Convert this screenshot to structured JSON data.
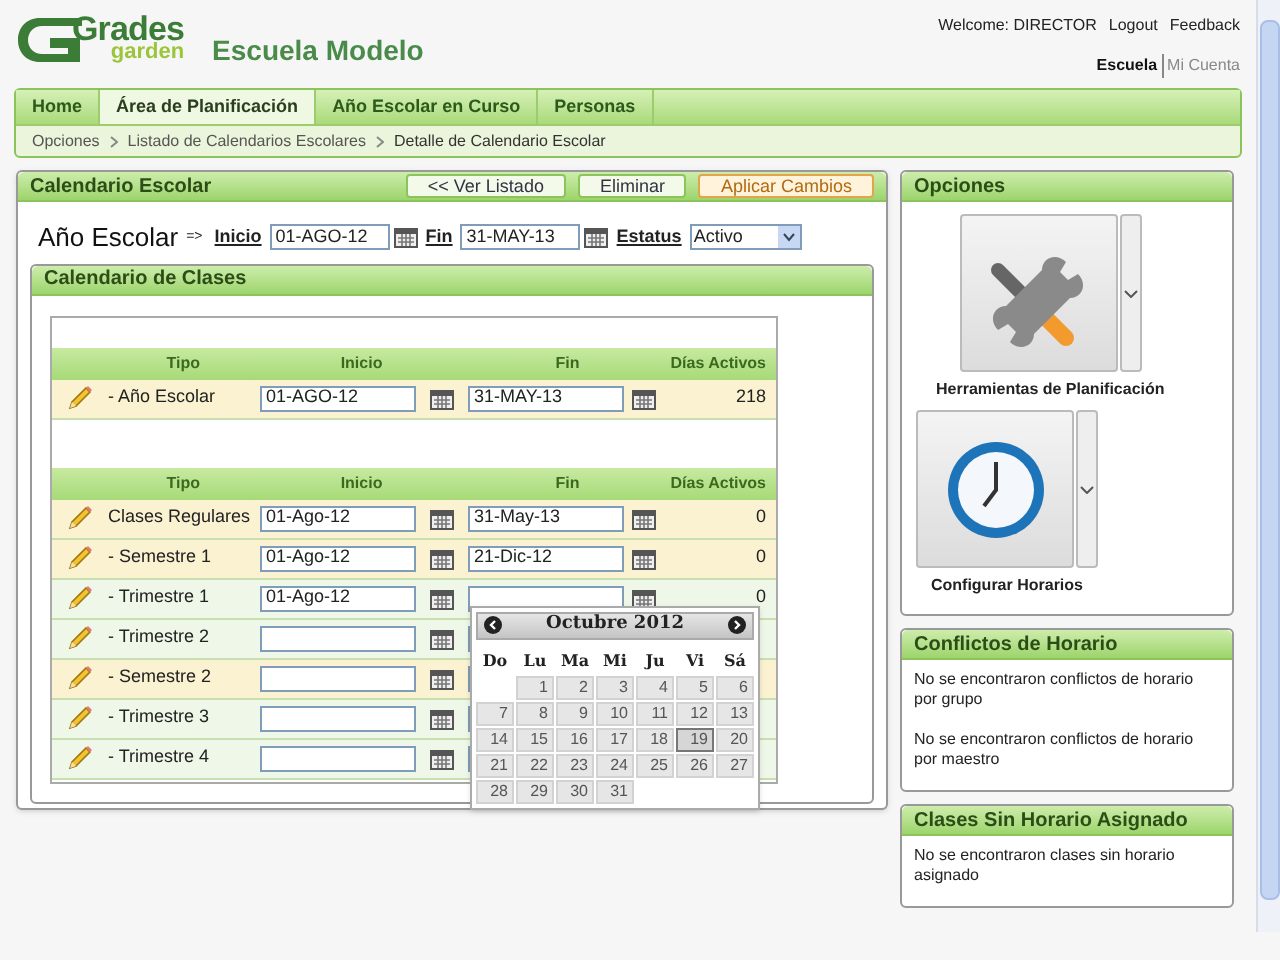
{
  "header": {
    "logo_top": "Grades",
    "logo_bottom": "garden",
    "school": "Escuela Modelo",
    "welcome": "Welcome: DIRECTOR",
    "links": [
      "Logout",
      "Feedback"
    ],
    "account_tabs": [
      {
        "label": "Escuela",
        "selected": true
      },
      {
        "label": "Mi Cuenta",
        "selected": false
      }
    ]
  },
  "nav": {
    "tabs": [
      {
        "label": "Home",
        "selected": false
      },
      {
        "label": "Área de Planificación",
        "selected": true
      },
      {
        "label": "Año Escolar en Curso",
        "selected": false
      },
      {
        "label": "Personas",
        "selected": false
      }
    ],
    "breadcrumb": [
      "Opciones",
      "Listado de Calendarios Escolares",
      "Detalle de Calendario Escolar"
    ]
  },
  "school_calendar": {
    "title": "Calendario Escolar",
    "buttons": [
      {
        "label": "<< Ver Listado",
        "kind": "normal"
      },
      {
        "label": "Eliminar",
        "kind": "normal"
      },
      {
        "label": "Aplicar Cambios",
        "kind": "primary"
      }
    ],
    "year_label": "Año Escolar",
    "arrow": "=>",
    "start_label": "Inicio",
    "start": "01-AGO-12",
    "end_label": "Fin",
    "end": "31-MAY-13",
    "status_label": "Estatus",
    "status": "Activo"
  },
  "class_calendar": {
    "title": "Calendario de Clases",
    "sections": [
      {
        "columns": [
          "Tipo",
          "Inicio",
          "Fin",
          "Días Activos"
        ],
        "rows": [
          {
            "kind": "year",
            "type": "- Año Escolar",
            "start": "01-AGO-12",
            "end": "31-MAY-13",
            "days": "218"
          }
        ]
      },
      {
        "columns": [
          "Tipo",
          "Inicio",
          "Fin",
          "Días Activos"
        ],
        "rows": [
          {
            "kind": "regular",
            "type": "Clases Regulares",
            "start": "01-Ago-12",
            "end": "31-May-13",
            "days": "0"
          },
          {
            "kind": "semester",
            "type": "- Semestre 1",
            "start": "01-Ago-12",
            "end": "21-Dic-12",
            "days": "0"
          },
          {
            "kind": "trimester",
            "type": "- Trimestre 1",
            "start": "01-Ago-12",
            "days": "0"
          },
          {
            "kind": "trimester",
            "type": "- Trimestre 2"
          },
          {
            "kind": "semester",
            "type": "- Semestre 2"
          },
          {
            "kind": "trimester",
            "type": "- Trimestre 3"
          },
          {
            "kind": "trimester",
            "type": "- Trimestre 4"
          }
        ]
      }
    ]
  },
  "date_picker": {
    "month": "Octubre 2012",
    "weekdays": [
      "Do",
      "Lu",
      "Ma",
      "Mi",
      "Ju",
      "Vi",
      "Sá"
    ],
    "weeks": [
      [
        {
          "day": "1",
          "selected": false
        },
        {
          "day": "2",
          "selected": false
        },
        {
          "day": "3",
          "selected": false
        },
        {
          "day": "4",
          "selected": false
        },
        {
          "day": "5",
          "selected": false
        },
        {
          "day": "6",
          "selected": false
        }
      ],
      [
        {
          "day": "7",
          "selected": false
        },
        {
          "day": "8",
          "selected": false
        },
        {
          "day": "9",
          "selected": false
        },
        {
          "day": "10",
          "selected": false
        },
        {
          "day": "11",
          "selected": false
        },
        {
          "day": "12",
          "selected": false
        },
        {
          "day": "13",
          "selected": false
        }
      ],
      [
        {
          "day": "14",
          "selected": false
        },
        {
          "day": "15",
          "selected": false
        },
        {
          "day": "16",
          "selected": false
        },
        {
          "day": "17",
          "selected": false
        },
        {
          "day": "18",
          "selected": false
        },
        {
          "day": "19",
          "selected": true
        },
        {
          "day": "20",
          "selected": false
        }
      ],
      [
        {
          "day": "21",
          "selected": false
        },
        {
          "day": "22",
          "selected": false
        },
        {
          "day": "23",
          "selected": false
        },
        {
          "day": "24",
          "selected": false
        },
        {
          "day": "25",
          "selected": false
        },
        {
          "day": "26",
          "selected": false
        },
        {
          "day": "27",
          "selected": false
        }
      ],
      [
        {
          "day": "28",
          "selected": false
        },
        {
          "day": "29",
          "selected": false
        },
        {
          "day": "30",
          "selected": false
        },
        {
          "day": "31",
          "selected": false
        }
      ]
    ]
  },
  "options": {
    "title": "Opciones",
    "tiles": [
      {
        "kind": "tools",
        "label": "Herramientas de Planificación"
      },
      {
        "kind": "clock",
        "label": "Configurar Horarios"
      }
    ]
  },
  "conflicts": {
    "title": "Conflictos de Horario",
    "messages": [
      "No se encontraron conflictos de horario por grupo",
      "No se encontraron conflictos de horario por maestro"
    ]
  },
  "unscheduled": {
    "title": "Clases Sin Horario Asignado",
    "messages": [
      "No se encontraron clases sin horario asignado"
    ]
  }
}
